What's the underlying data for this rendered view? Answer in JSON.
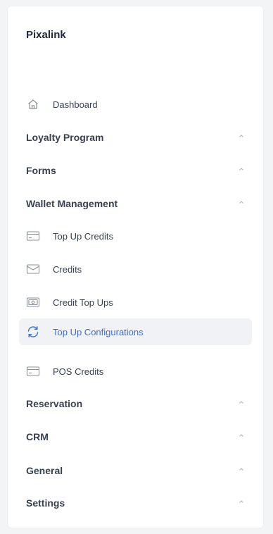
{
  "sidebar": {
    "brand": "Pixalink",
    "dashboard": {
      "label": "Dashboard",
      "icon": "home-icon"
    },
    "sections": [
      {
        "label": "Loyalty Program"
      },
      {
        "label": "Forms"
      },
      {
        "label": "Wallet Management"
      },
      {
        "label": "Reservation"
      },
      {
        "label": "CRM"
      },
      {
        "label": "General"
      },
      {
        "label": "Settings"
      }
    ],
    "wallet_items": [
      {
        "label": "Top Up Credits",
        "icon": "credit-card-icon"
      },
      {
        "label": "Credits",
        "icon": "wallet-icon"
      },
      {
        "label": "Credit Top Ups",
        "icon": "cash-icon"
      },
      {
        "label": "Top Up Configurations",
        "icon": "refresh-icon",
        "active": true
      },
      {
        "label": "POS Credits",
        "icon": "credit-card-icon"
      }
    ]
  },
  "colors": {
    "accent": "#3b6fd9",
    "text": "#374151",
    "active_bg": "#f1f2f5"
  }
}
